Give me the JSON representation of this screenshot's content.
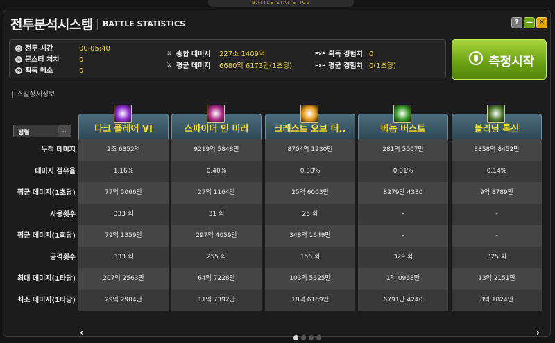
{
  "top_strip": "BATTLE STATISTICS",
  "window": {
    "title_ko": "전투분석시스템",
    "title_en": "BATTLE STATISTICS",
    "help_label": "?",
    "min_label": "—",
    "close_label": "✕"
  },
  "stats": {
    "battle_time": {
      "label": "전투 시간",
      "value": "00:05:40",
      "icon": "clock-icon"
    },
    "monsters": {
      "label": "몬스터 처치",
      "value": "0",
      "icon": "skull-icon"
    },
    "meso": {
      "label": "획득 메소",
      "value": "0",
      "icon": "meso-icon",
      "icon_glyph": "M"
    },
    "total_damage": {
      "label": "총합 데미지",
      "value": "227조 1409억",
      "icon": "sword-icon"
    },
    "avg_damage": {
      "label": "평균 데미지",
      "value": "6680억 6173만(1초당)",
      "icon": "sword-icon"
    },
    "exp_gain": {
      "label": "획득 경험치",
      "value": "0",
      "icon_text": "EXP"
    },
    "avg_exp": {
      "label": "평균 경험치",
      "value": "0(1초당)",
      "icon_text": "EXP"
    }
  },
  "measure_button": {
    "label": "측정시작"
  },
  "section_label": "스킬상세정보",
  "sort_select": {
    "selected": "정렬",
    "arrow": "⌄"
  },
  "row_labels": [
    "누적 데미지",
    "데미지 점유율",
    "평균 데미지(1초당)",
    "사용횟수",
    "평균 데미지(1회당)",
    "공격횟수",
    "최대 데미지(1타당)",
    "최소 데미지(1타당)"
  ],
  "skills": [
    {
      "name": "다크 플레어 VI",
      "icon_color": "#8e2bd1",
      "values": [
        "2조 6352억",
        "1.16%",
        "77억 5066만",
        "333 회",
        "79억 1359만",
        "333 회",
        "207억 2563만",
        "29억 2904만"
      ]
    },
    {
      "name": "스파이더 인 미러",
      "icon_color": "#b02a86",
      "values": [
        "9219억 5848만",
        "0.40%",
        "27억 1164만",
        "31 회",
        "297억 4059만",
        "255 회",
        "64억 7228만",
        "11억 7392만"
      ]
    },
    {
      "name": "크레스트 오브 더..",
      "icon_color": "#e89a1a",
      "values": [
        "8704억 1230만",
        "0.38%",
        "25억 6003만",
        "25 회",
        "348억 1649만",
        "156 회",
        "103억 5625만",
        "18억 6169만"
      ]
    },
    {
      "name": "베놈 버스트",
      "icon_color": "#3a9a2a",
      "values": [
        "281억 5007만",
        "0.01%",
        "8279만 4330",
        "-",
        "-",
        "329 회",
        "1억 0968만",
        "6791만 4240"
      ]
    },
    {
      "name": "블리딩 톡신",
      "icon_color": "#4f7a2c",
      "values": [
        "3358억 8452만",
        "0.14%",
        "9억 8789만",
        "-",
        "-",
        "325 회",
        "13억 2151만",
        "8억 1824만"
      ]
    }
  ],
  "pager": {
    "total": 4,
    "active": 0,
    "prev": "‹",
    "next": "›"
  }
}
